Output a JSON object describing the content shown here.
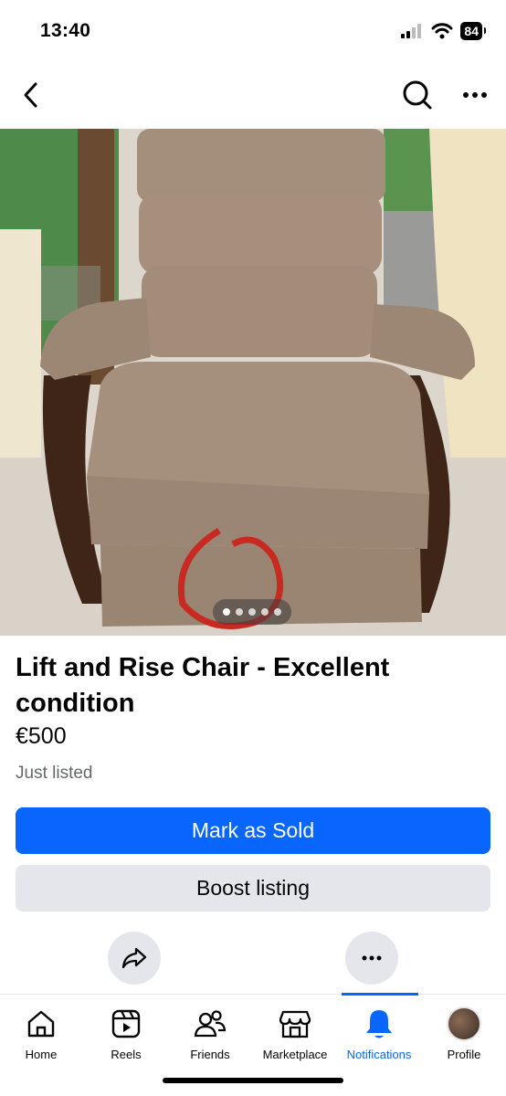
{
  "status_bar": {
    "time": "13:40",
    "battery": "84",
    "icons": [
      "signal-icon",
      "wifi-icon",
      "battery-icon"
    ]
  },
  "nav": {
    "back_icon": "chevron-left-icon",
    "search_icon": "search-icon",
    "more_icon": "more-horizontal-icon"
  },
  "listing": {
    "photo_description_icon": "chair-photo",
    "photo_count": 5,
    "photo_active_index": 0,
    "title": "Lift and Rise Chair - Excellent condition",
    "price": "€500",
    "listed_status": "Just listed"
  },
  "actions": {
    "mark_sold_label": "Mark as Sold",
    "boost_label": "Boost listing",
    "share_icon": "share-icon",
    "more_icon": "more-horizontal-icon"
  },
  "tabs": [
    {
      "label": "Home",
      "icon": "home-icon",
      "active": false
    },
    {
      "label": "Reels",
      "icon": "reels-icon",
      "active": false
    },
    {
      "label": "Friends",
      "icon": "friends-icon",
      "active": false
    },
    {
      "label": "Marketplace",
      "icon": "marketplace-icon",
      "active": false
    },
    {
      "label": "Notifications",
      "icon": "bell-icon",
      "active": true
    },
    {
      "label": "Profile",
      "icon": "avatar",
      "active": false
    }
  ],
  "colors": {
    "accent": "#0866ff",
    "secondary_button": "#e4e6eb",
    "muted_text": "#65676b"
  }
}
